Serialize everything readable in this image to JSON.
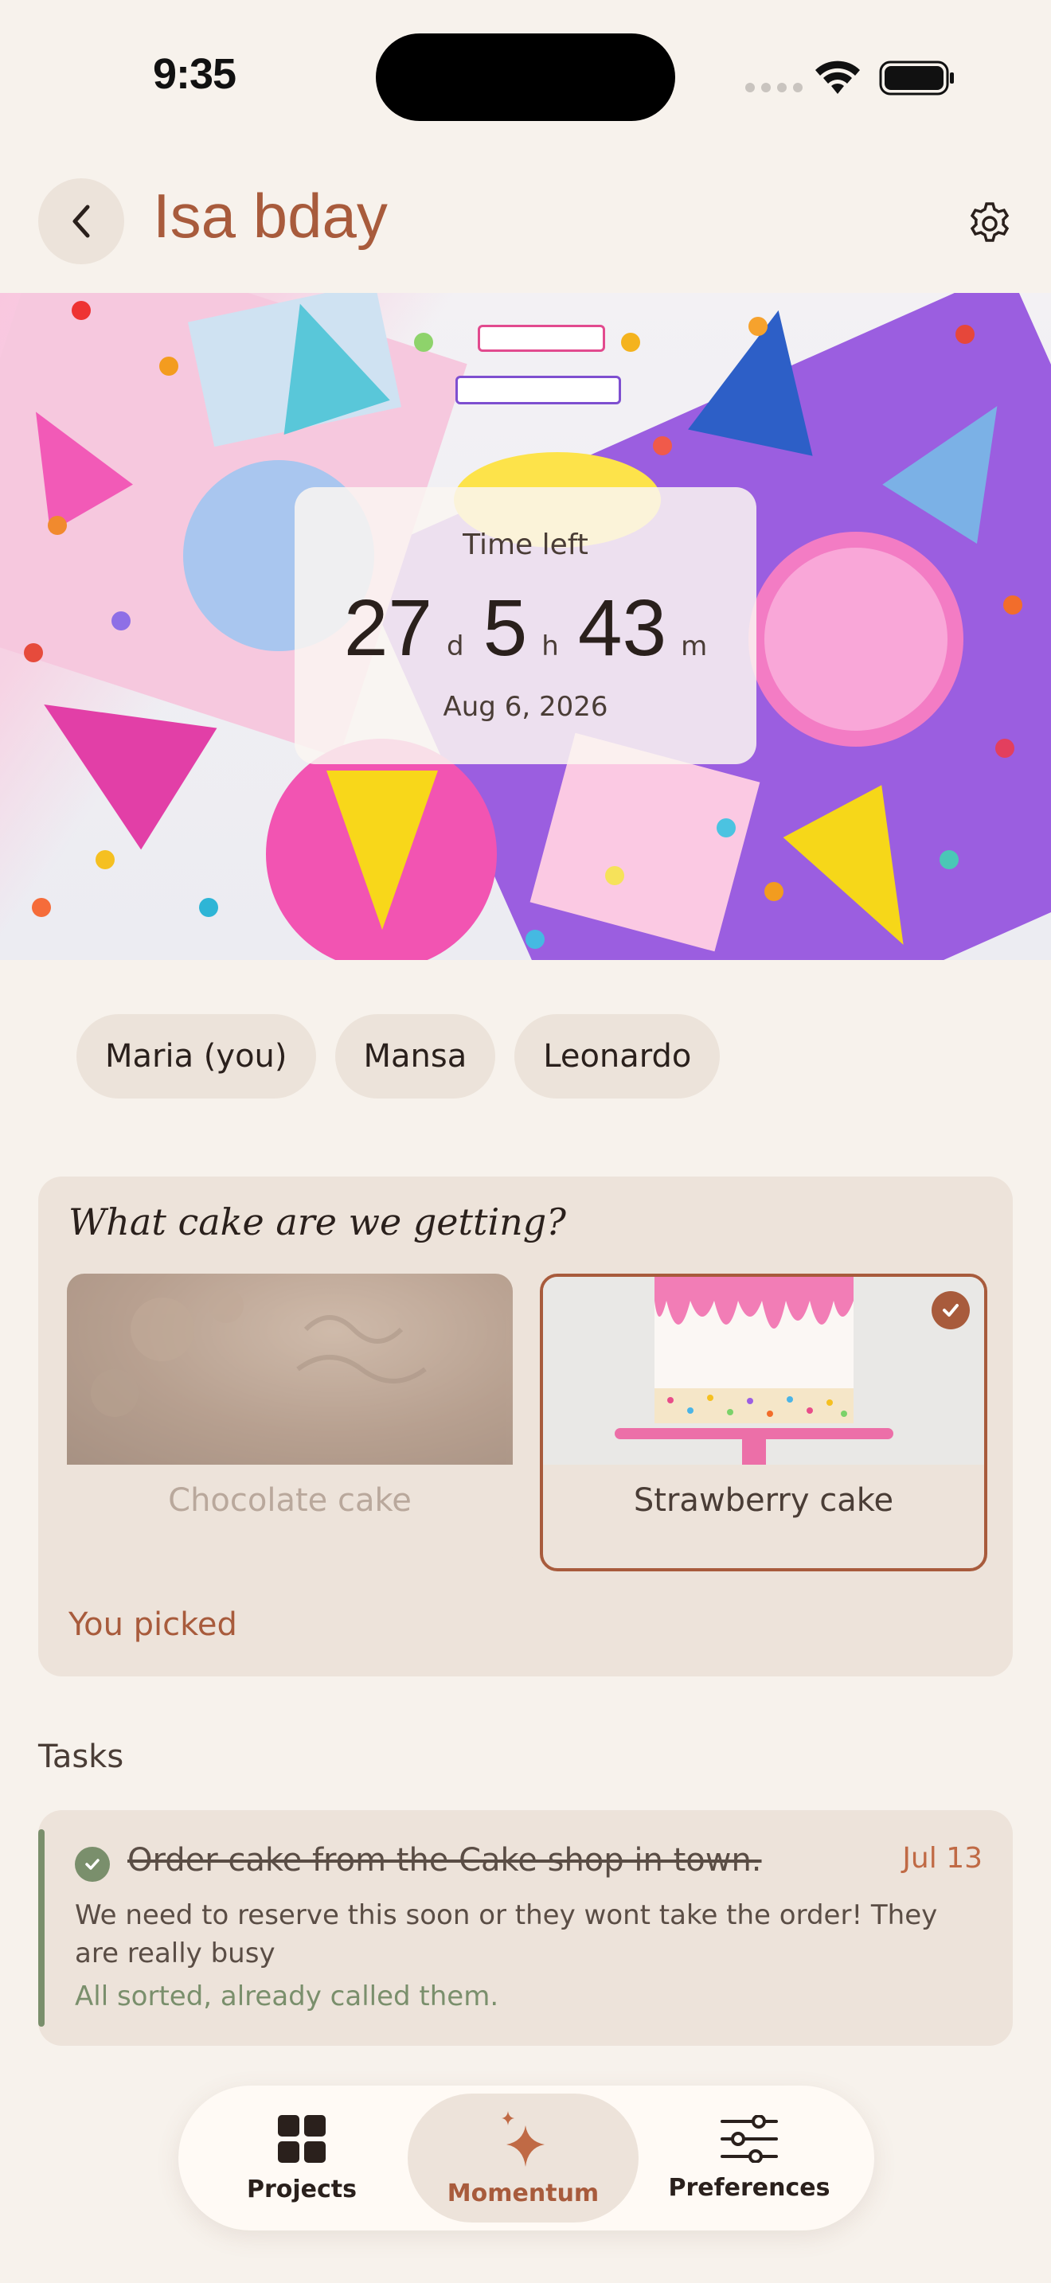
{
  "status_bar": {
    "time": "9:35"
  },
  "header": {
    "title": "Isa bday"
  },
  "countdown": {
    "label": "Time left",
    "days": "27",
    "days_unit": "d",
    "hours": "5",
    "hours_unit": "h",
    "minutes": "43",
    "minutes_unit": "m",
    "date": "Aug 6, 2026"
  },
  "participants": [
    "Maria (you)",
    "Mansa",
    "Leonardo"
  ],
  "poll": {
    "question": "What cake are we getting?",
    "options": [
      {
        "label": "Chocolate cake",
        "selected": false
      },
      {
        "label": "Strawberry cake",
        "selected": true
      }
    ],
    "status": "You picked"
  },
  "tasks": {
    "heading": "Tasks",
    "items": [
      {
        "title": "Order cake from the Cake shop in town.",
        "date": "Jul 13",
        "description": "We need to reserve this soon or they wont take the order! They are really busy",
        "note": "All sorted, already called them.",
        "done": true
      }
    ]
  },
  "nav": {
    "items": [
      {
        "label": "Projects",
        "icon": "grid-icon",
        "active": false
      },
      {
        "label": "Momentum",
        "icon": "sparkle-icon",
        "active": true
      },
      {
        "label": "Preferences",
        "icon": "sliders-icon",
        "active": false
      }
    ]
  },
  "colors": {
    "accent": "#a85b3c",
    "success": "#7a8f6c",
    "background": "#f7f2ec",
    "card": "#ede3da"
  }
}
